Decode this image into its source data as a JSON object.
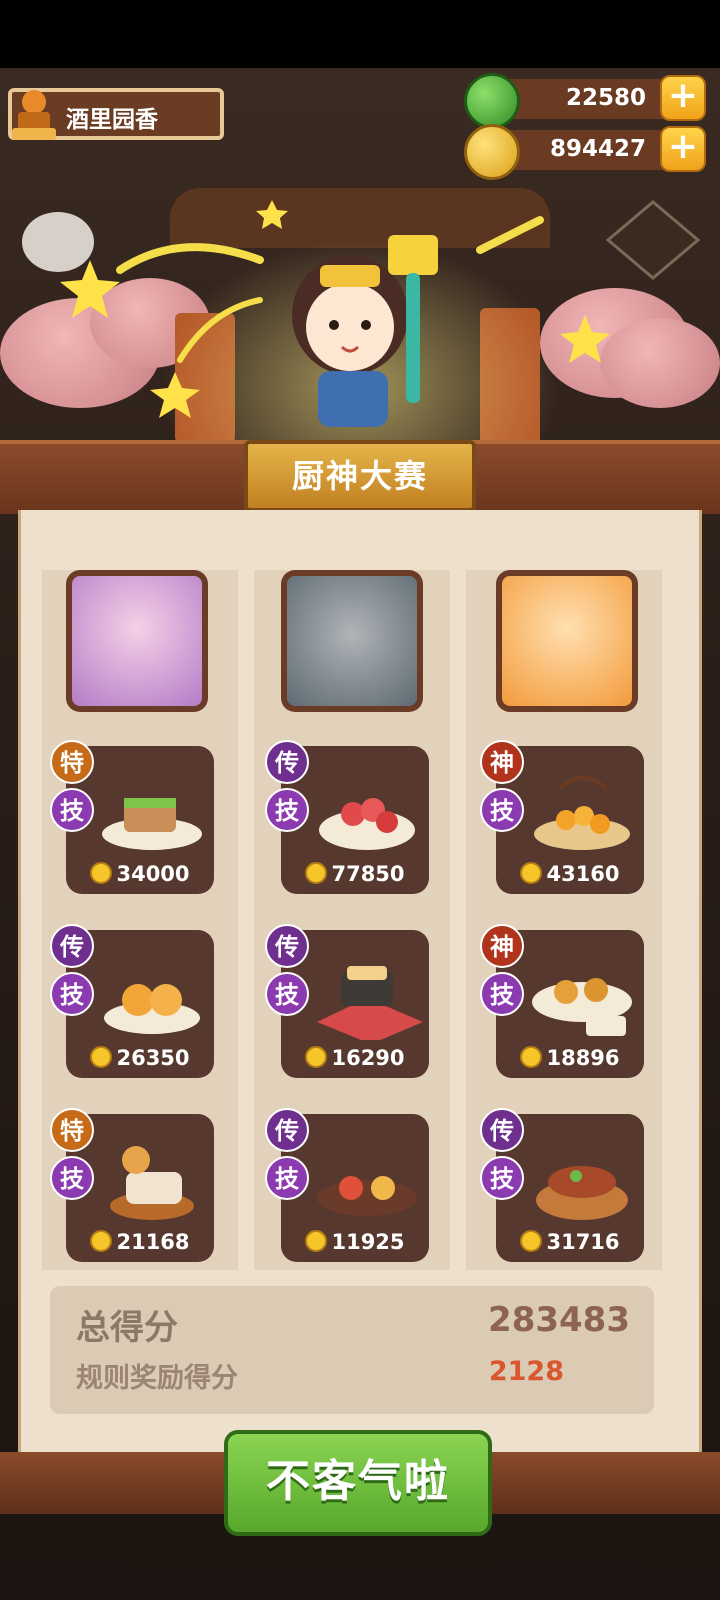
{
  "player": {
    "name": "酒里园香"
  },
  "resources": [
    {
      "name": "jade",
      "value": "22580",
      "icon": "jade-coin-icon"
    },
    {
      "name": "coin",
      "value": "894427",
      "icon": "gold-coin-icon"
    }
  ],
  "title": "厨神大赛",
  "columns": [
    {
      "chef": "chef-portrait-purple-hair",
      "dishes": [
        {
          "tier": "特",
          "skill": "技",
          "price": "34000"
        },
        {
          "tier": "传",
          "skill": "技",
          "price": "26350"
        },
        {
          "tier": "特",
          "skill": "技",
          "price": "21168"
        }
      ]
    },
    {
      "chef": "chef-portrait-wolf",
      "dishes": [
        {
          "tier": "传",
          "skill": "技",
          "price": "77850"
        },
        {
          "tier": "传",
          "skill": "技",
          "price": "16290"
        },
        {
          "tier": "传",
          "skill": "技",
          "price": "11925"
        }
      ]
    },
    {
      "chef": "chef-portrait-orange-hair",
      "dishes": [
        {
          "tier": "神",
          "skill": "技",
          "price": "43160"
        },
        {
          "tier": "神",
          "skill": "技",
          "price": "18896"
        },
        {
          "tier": "传",
          "skill": "技",
          "price": "31716"
        }
      ]
    }
  ],
  "score": {
    "total_label": "总得分",
    "total_value": "283483",
    "bonus_label": "规则奖励得分",
    "bonus_value": "2128"
  },
  "confirm_button": "不客气啦",
  "colors": {
    "accent_green": "#6cc23a",
    "title_gold": "#d89b2e",
    "bonus_red": "#d9562e"
  }
}
